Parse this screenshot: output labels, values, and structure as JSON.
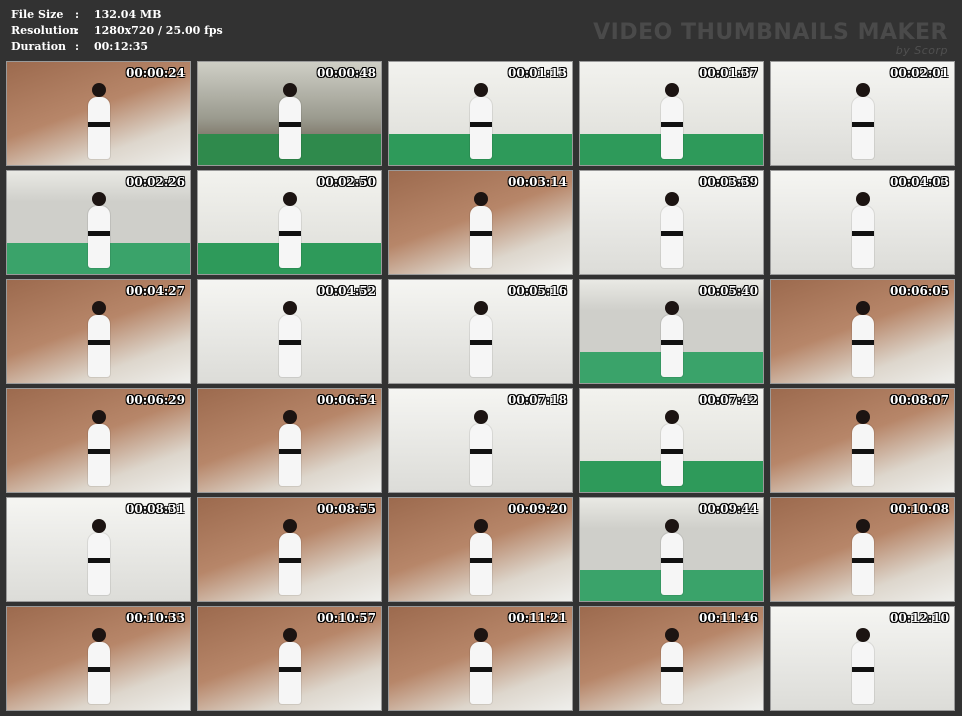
{
  "info": {
    "file_size_label": "File Size",
    "file_size": "132.04 MB",
    "resolution_label": "Resolution",
    "resolution": "1280x720 / 25.00 fps",
    "duration_label": "Duration",
    "duration": "00:12:35",
    "separator": ":"
  },
  "brand": {
    "title": "VIDEO THUMBNAILS MAKER",
    "subtitle": "by Scorp"
  },
  "thumbnails": [
    {
      "time": "00:00:24",
      "scene": "brick"
    },
    {
      "time": "00:00:48",
      "scene": "room"
    },
    {
      "time": "00:01:13",
      "scene": "dojo"
    },
    {
      "time": "00:01:37",
      "scene": "dojo"
    },
    {
      "time": "00:02:01",
      "scene": "white"
    },
    {
      "time": "00:02:26",
      "scene": "mat"
    },
    {
      "time": "00:02:50",
      "scene": "dojo"
    },
    {
      "time": "00:03:14",
      "scene": "brick"
    },
    {
      "time": "00:03:39",
      "scene": "white"
    },
    {
      "time": "00:04:03",
      "scene": "white"
    },
    {
      "time": "00:04:27",
      "scene": "brick"
    },
    {
      "time": "00:04:52",
      "scene": "white"
    },
    {
      "time": "00:05:16",
      "scene": "white"
    },
    {
      "time": "00:05:40",
      "scene": "mat"
    },
    {
      "time": "00:06:05",
      "scene": "brick"
    },
    {
      "time": "00:06:29",
      "scene": "brick"
    },
    {
      "time": "00:06:54",
      "scene": "brick"
    },
    {
      "time": "00:07:18",
      "scene": "white"
    },
    {
      "time": "00:07:42",
      "scene": "dojo"
    },
    {
      "time": "00:08:07",
      "scene": "brick"
    },
    {
      "time": "00:08:31",
      "scene": "white"
    },
    {
      "time": "00:08:55",
      "scene": "brick"
    },
    {
      "time": "00:09:20",
      "scene": "brick"
    },
    {
      "time": "00:09:44",
      "scene": "mat"
    },
    {
      "time": "00:10:08",
      "scene": "brick"
    },
    {
      "time": "00:10:33",
      "scene": "brick"
    },
    {
      "time": "00:10:57",
      "scene": "brick"
    },
    {
      "time": "00:11:21",
      "scene": "brick"
    },
    {
      "time": "00:11:46",
      "scene": "brick"
    },
    {
      "time": "00:12:10",
      "scene": "white"
    }
  ]
}
